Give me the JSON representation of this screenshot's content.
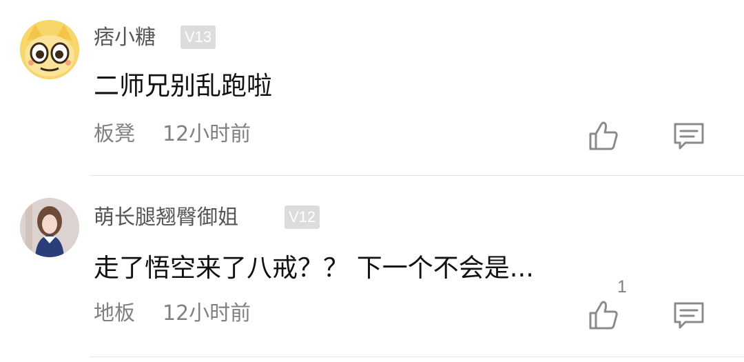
{
  "comments": [
    {
      "username": "痞小糖",
      "level": "V13",
      "content": "二师兄别乱跑啦",
      "floor": "板凳",
      "time": "12小时前",
      "likes": "",
      "avatar": "cartoon-face-avatar"
    },
    {
      "username": "萌长腿翘臀御姐",
      "level": "V12",
      "content": "走了悟空来了八戒？？ 下一个不会是...",
      "floor": "地板",
      "time": "12小时前",
      "likes": "1",
      "avatar": "photo-avatar"
    }
  ],
  "icons": {
    "like": "thumbs-up-icon",
    "reply": "comment-bubble-icon"
  },
  "colors": {
    "username": "#555555",
    "meta": "#808080",
    "badge_bg": "#dcdcdc",
    "content": "#111111"
  }
}
